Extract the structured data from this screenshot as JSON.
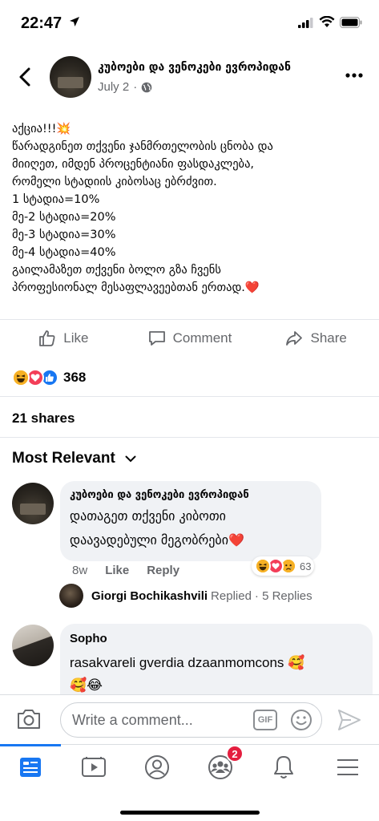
{
  "status_bar": {
    "time": "22:47"
  },
  "post": {
    "page_name": "კუბოები და ვენოკები ევროპიდან",
    "date": "July 2",
    "lines": [
      "აქცია!!!💥",
      "წარადგინეთ თქვენი ჯანმრთელობის ცნობა და",
      "მიიღეთ, იმდენ პროცენტიანი ფასდაკლება,",
      "რომელი სტადიის კიბოსაც ებრძვით.",
      "1 სტადია=10%",
      "მე-2 სტადია=20%",
      "მე-3 სტადია=30%",
      "მე-4 სტადია=40%",
      "გაილამაზეთ თქვენი ბოლო გზა ჩვენს",
      "პროფესიონალ მესაფლავეებთან ერთად.❤️"
    ],
    "actions": {
      "like": "Like",
      "comment": "Comment",
      "share": "Share"
    },
    "reaction_count": "368",
    "shares": "21 shares"
  },
  "comments_section": {
    "sort_label": "Most Relevant",
    "comments": [
      {
        "name": "კუბოები და ვენოკები ევროპიდან",
        "line1": "დათაგეთ თქვენი კიბოთი",
        "line2": "დაავადებული მეგობრები❤️",
        "age": "8w",
        "like": "Like",
        "reply": "Reply",
        "reaction_count": "63",
        "reply_summary": {
          "name": "Giorgi Bochikashvili",
          "verb": "Replied",
          "count": "· 5 Replies"
        }
      },
      {
        "name": "Sopho",
        "line1": "rasakvareli gverdia dzaanmomcons 🥰",
        "line2": "🥰😂"
      }
    ]
  },
  "composer": {
    "placeholder": "Write a comment...",
    "gif_label": "GIF"
  },
  "tabbar": {
    "groups_badge": "2"
  },
  "colors": {
    "accent": "#1877f2",
    "like_blue": "#1877f2",
    "love_red": "#f33e58",
    "haha_yellow": "#f7b125"
  }
}
